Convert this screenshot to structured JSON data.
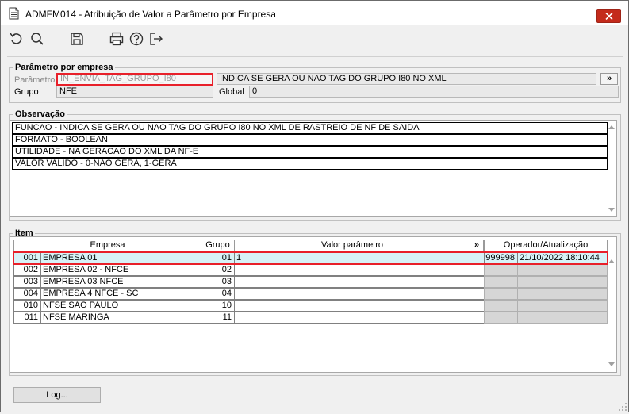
{
  "window": {
    "title": "ADMFM014 - Atribuição de Valor a Parâmetro por Empresa",
    "close_icon": "close-icon"
  },
  "toolbar": {
    "items": [
      "refresh-icon",
      "search-icon",
      "save-icon",
      "print-icon",
      "help-icon",
      "exit-icon"
    ]
  },
  "param_group": {
    "title": "Parâmetro por empresa",
    "parametro_label": "Parâmetro",
    "parametro_value": "IN_ENVIA_TAG_GRUPO_I80",
    "parametro_desc": "INDICA SE GERA OU NAO TAG DO GRUPO I80 NO XML",
    "lookup_label": "»",
    "grupo_label": "Grupo",
    "grupo_value": "NFE",
    "global_label": "Global",
    "global_value": "0"
  },
  "obs_group": {
    "title": "Observação",
    "lines": [
      "FUNCAO - INDICA SE GERA OU NAO TAG DO GRUPO I80 NO XML DE RASTREIO DE NF DE SAIDA",
      "FORMATO - BOOLEAN",
      "UTILIDADE - NA GERACAO DO XML DA NF-E",
      "VALOR VALIDO -  0-NAO GERA,  1-GERA"
    ]
  },
  "item_group": {
    "title": "Item",
    "columns": {
      "empresa": "Empresa",
      "grupo": "Grupo",
      "valor": "Valor parâmetro",
      "more": "»",
      "operador": "Operador/Atualização"
    },
    "rows": [
      {
        "code": "001",
        "empresa": "EMPRESA 01",
        "grupo": "01",
        "valor": "1",
        "operador": "999998",
        "atualizacao": "21/10/2022 18:10:44"
      },
      {
        "code": "002",
        "empresa": "EMPRESA 02 - NFCE",
        "grupo": "02",
        "valor": "",
        "operador": "",
        "atualizacao": ""
      },
      {
        "code": "003",
        "empresa": "EMPRESA 03 NFCE",
        "grupo": "03",
        "valor": "",
        "operador": "",
        "atualizacao": ""
      },
      {
        "code": "004",
        "empresa": "EMPRESA 4 NFCE - SC",
        "grupo": "04",
        "valor": "",
        "operador": "",
        "atualizacao": ""
      },
      {
        "code": "010",
        "empresa": "NFSE SAO PAULO",
        "grupo": "10",
        "valor": "",
        "operador": "",
        "atualizacao": ""
      },
      {
        "code": "011",
        "empresa": "NFSE MARINGA",
        "grupo": "11",
        "valor": "",
        "operador": "",
        "atualizacao": ""
      }
    ]
  },
  "footer": {
    "log_label": "Log..."
  }
}
